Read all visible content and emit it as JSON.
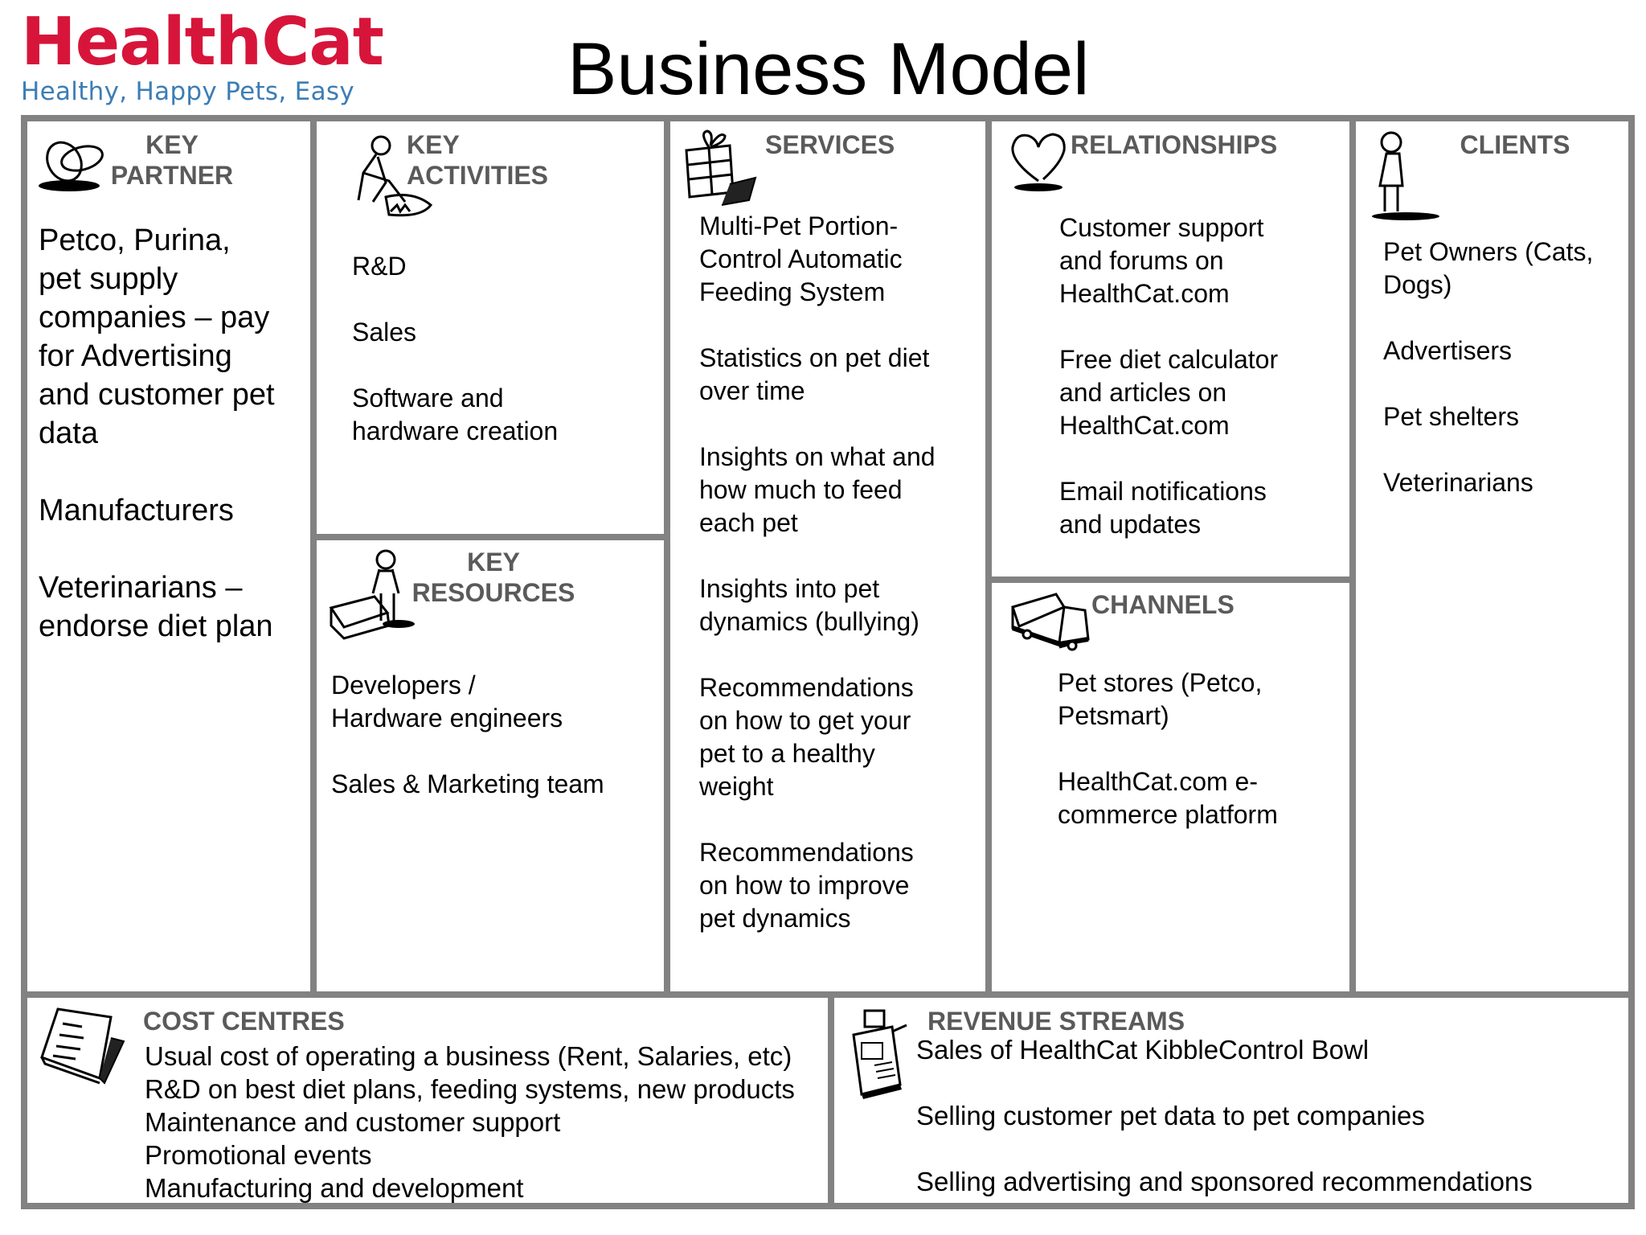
{
  "header": {
    "brand_name": "HealthCat",
    "brand_tagline": "Healthy, Happy Pets, Easy",
    "title": "Business Model",
    "colors": {
      "brand_red": "#d7153a",
      "tagline_blue": "#3d7db5",
      "header_gray": "#5a5a5a",
      "border_gray": "#828282"
    }
  },
  "canvas": {
    "key_partner": {
      "title_lines": [
        "KEY",
        "PARTNER"
      ],
      "icon": "linked-rings-icon",
      "items": [
        "Petco, Purina, pet supply companies – pay for Advertising and customer pet data",
        "Manufacturers",
        "Veterinarians – endorse diet plan"
      ]
    },
    "key_activities": {
      "title_lines": [
        "KEY",
        "ACTIVITIES"
      ],
      "icon": "digging-person-icon",
      "items": [
        "R&D",
        "Sales",
        "Software and hardware creation"
      ]
    },
    "key_resources": {
      "title_lines": [
        "KEY",
        "RESOURCES"
      ],
      "icon": "person-with-machine-icon",
      "items": [
        "Developers / Hardware engineers",
        "Sales & Marketing team"
      ]
    },
    "services": {
      "title": "SERVICES",
      "icon": "gift-box-icon",
      "items": [
        "Multi-Pet Portion-Control Automatic Feeding System",
        "Statistics on pet diet over time",
        "Insights on what and how much to feed each pet",
        "Insights into pet dynamics (bullying)",
        "Recommendations on how to get your pet to a healthy weight",
        "Recommendations on how to improve pet dynamics"
      ]
    },
    "relationships": {
      "title": "RELATIONSHIPS",
      "icon": "heart-icon",
      "items": [
        "Customer support and forums on HealthCat.com",
        "Free diet calculator and articles on HealthCat.com",
        "Email notifications and updates"
      ]
    },
    "channels": {
      "title": "CHANNELS",
      "icon": "truck-icon",
      "items": [
        "Pet stores (Petco, Petsmart)",
        "HealthCat.com e-commerce platform"
      ]
    },
    "clients": {
      "title": "CLIENTS",
      "icon": "standing-person-icon",
      "items": [
        "Pet Owners (Cats, Dogs)",
        "Advertisers",
        "Pet shelters",
        "Veterinarians"
      ]
    },
    "cost_centres": {
      "title": "COST CENTRES",
      "icon": "paper-stack-icon",
      "items": [
        "Usual cost of operating a business (Rent, Salaries, etc)",
        "R&D on best diet plans, feeding systems, new products",
        "Maintenance and customer support",
        "Promotional events",
        "Manufacturing and development"
      ]
    },
    "revenue_streams": {
      "title": "REVENUE STREAMS",
      "icon": "cash-register-icon",
      "items": [
        "Sales of HealthCat KibbleControl Bowl",
        "Selling customer pet data to pet companies",
        "Selling advertising and sponsored recommendations"
      ]
    }
  }
}
